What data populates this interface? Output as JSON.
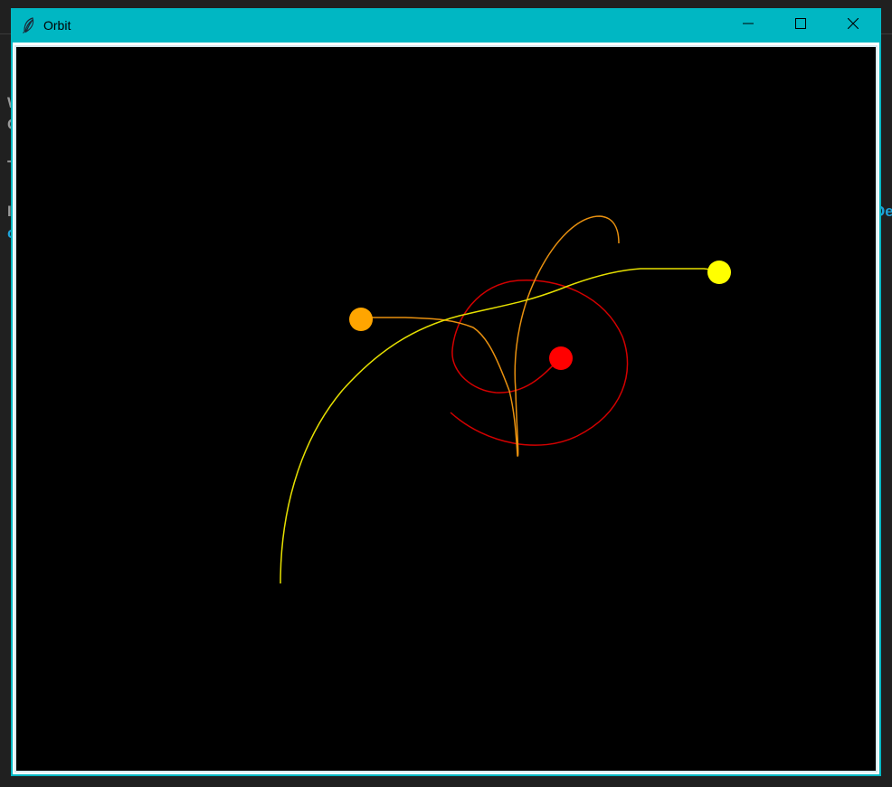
{
  "window": {
    "title": "Orbit",
    "accent_color": "#00b7c3",
    "controls": {
      "minimize_icon": "minimize-icon",
      "maximize_icon": "maximize-icon",
      "close_icon": "close-icon"
    },
    "app_icon": "feather-icon"
  },
  "canvas": {
    "background": "#000000",
    "bodies": [
      {
        "name": "red",
        "color": "#ff0000"
      },
      {
        "name": "orange",
        "color": "#ffa500"
      },
      {
        "name": "yellow",
        "color": "#ffff00"
      }
    ]
  },
  "background_fragments": {
    "left": [
      "W",
      "C",
      "T",
      "I",
      "c"
    ],
    "right": "De"
  }
}
